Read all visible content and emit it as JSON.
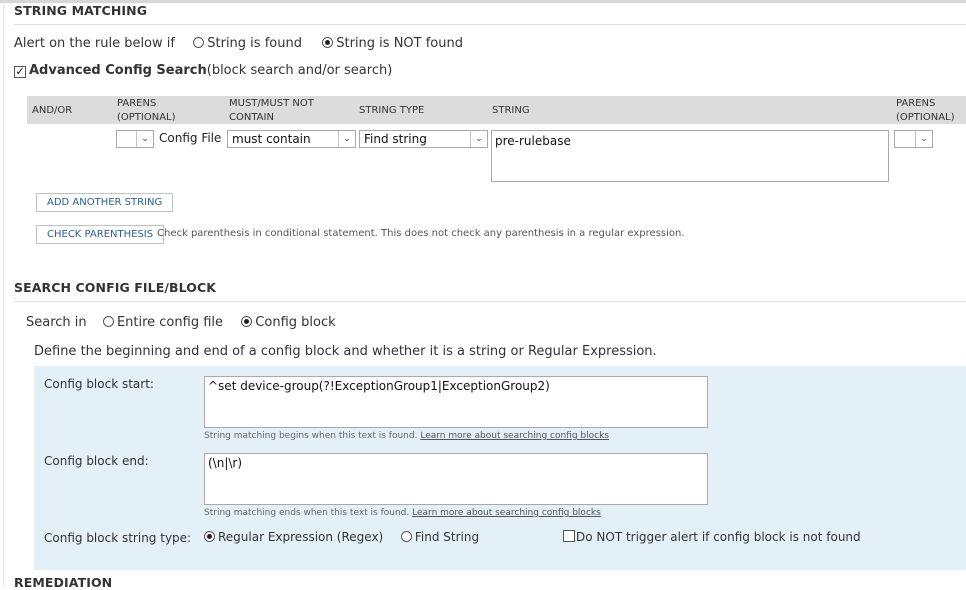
{
  "string_matching": {
    "heading": "STRING MATCHING",
    "alert_label": "Alert on the rule below if",
    "radio_found": "String is found",
    "radio_not_found": "String is NOT found",
    "advanced_label": "Advanced Config Search",
    "advanced_hint": "(block search and/or search)",
    "columns": {
      "and_or": "AND/OR",
      "parens_open_1": "PARENS",
      "parens_open_2": "(OPTIONAL)",
      "must_1": "MUST/MUST NOT",
      "must_2": "CONTAIN",
      "string_type": "STRING TYPE",
      "string": "STRING",
      "parens_close_1": "PARENS",
      "parens_close_2": "(OPTIONAL)"
    },
    "row": {
      "scope_label": "Config File",
      "must_value": "must contain",
      "type_value": "Find string",
      "string_value": "pre-rulebase"
    },
    "add_button": "ADD ANOTHER STRING",
    "check_button": "CHECK PARENTHESIS",
    "check_note": "Check parenthesis in conditional statement. This does not check any parenthesis in a regular expression."
  },
  "search_config": {
    "heading": "SEARCH CONFIG FILE/BLOCK",
    "search_in_label": "Search in",
    "radio_entire": "Entire config file",
    "radio_block": "Config block",
    "define_text": "Define the beginning and end of a config block and whether it is a string or Regular Expression.",
    "block_start_label": "Config block start:",
    "block_start_value": "^set device-group(?!ExceptionGroup1|ExceptionGroup2)",
    "block_start_help": "String matching begins when this text is found.",
    "block_end_label": "Config block end:",
    "block_end_value": "(\\n|\\r)",
    "block_end_help": "String matching ends when this text is found.",
    "learn_more": "Learn more about searching config blocks",
    "string_type_label": "Config block string type:",
    "radio_regex": "Regular Expression (Regex)",
    "radio_find": "Find String",
    "no_trigger_label": "Do NOT trigger alert if config block is not found"
  },
  "remediation": {
    "heading": "REMEDIATION"
  },
  "icons": {
    "dropdown": "chevron-down-icon",
    "check": "checkmark-icon"
  },
  "colors": {
    "header_bg": "#dcdcdc",
    "panel_bg": "#e4f0f7",
    "link": "#2a5f8f"
  }
}
